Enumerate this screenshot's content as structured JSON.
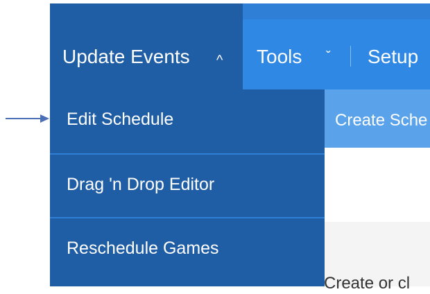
{
  "nav": {
    "update_events": "Update Events",
    "update_chevron": "^",
    "tools": "Tools",
    "tools_chevron": "ˇ",
    "setup": "Setup"
  },
  "dropdown": {
    "items": [
      {
        "label": "Edit Schedule"
      },
      {
        "label": "Drag 'n Drop Editor"
      },
      {
        "label": "Reschedule Games"
      }
    ]
  },
  "subnav": {
    "create": "Create Sche"
  },
  "content": {
    "text": "Create or cl"
  },
  "callout": {
    "icon": "arrow-right-icon",
    "color": "#4a6fb5"
  },
  "colors": {
    "nav_blue": "#2f7fd6",
    "active_blue": "#1f5ea5",
    "sub_blue": "#5aa3ea"
  }
}
